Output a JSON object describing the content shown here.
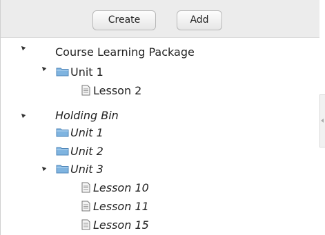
{
  "toolbar": {
    "create_label": "Create",
    "add_label": "Add"
  },
  "tree": {
    "course": {
      "label": "Course Learning Package",
      "unit1": {
        "label": "Unit 1",
        "lesson": "Lesson 2"
      }
    },
    "holding_bin": {
      "label": "Holding Bin",
      "units": [
        "Unit 1",
        "Unit 2",
        "Unit 3"
      ],
      "unit3_lessons": [
        "Lesson 10",
        "Lesson 11",
        "Lesson 15"
      ]
    }
  },
  "colors": {
    "folder": "#7fb4e0",
    "toolbar_bg": "#ececec"
  },
  "icons": {
    "folder": "folder-icon",
    "document": "document-icon",
    "expanded": "expanded-toggle-icon"
  }
}
